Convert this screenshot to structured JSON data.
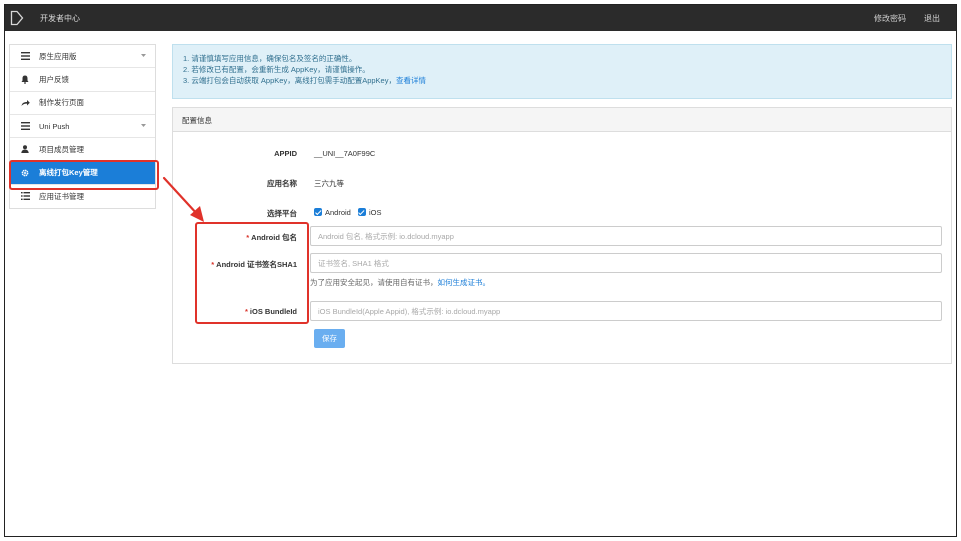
{
  "topbar": {
    "title": "开发者中心",
    "change_password": "修改密码",
    "logout": "退出"
  },
  "sidebar": {
    "items": [
      {
        "label": "原生应用版",
        "icon": "menu-icon",
        "has_caret": true
      },
      {
        "label": "用户反馈",
        "icon": "bell-icon",
        "has_caret": false
      },
      {
        "label": "制作发行页面",
        "icon": "share-arrow-icon",
        "has_caret": false
      },
      {
        "label": "Uni Push",
        "icon": "menu-icon",
        "has_caret": true
      },
      {
        "label": "项目成员管理",
        "icon": "user-icon",
        "has_caret": false
      },
      {
        "label": "离线打包Key管理",
        "icon": "gear-icon",
        "has_caret": false,
        "active": true
      },
      {
        "label": "应用证书管理",
        "icon": "list-icon",
        "has_caret": false
      }
    ]
  },
  "notice": {
    "line1": "1. 请谨慎填写应用信息，确保包名及签名的正确性。",
    "line2": "2. 若修改已有配置，会重新生成 AppKey，请谨慎操作。",
    "line3": "3. 云端打包会自动获取 AppKey，离线打包需手动配置AppKey，",
    "line3_link": "查看详情"
  },
  "panel": {
    "title": "配置信息",
    "appid_label": "APPID",
    "appid_value": "__UNI__7A0F99C",
    "appname_label": "应用名称",
    "appname_value": "三六九等",
    "platform_label": "选择平台",
    "platforms": [
      "Android",
      "iOS"
    ],
    "android_pkg_label": "Android 包名",
    "android_pkg_placeholder": "Android 包名, 格式示例: io.dcloud.myapp",
    "android_pkg_value": "",
    "android_sha1_label": "Android 证书签名SHA1",
    "android_sha1_placeholder": "证书签名, SHA1 格式",
    "android_sha1_value": "",
    "sha1_help": "为了应用安全起见，请使用自有证书，",
    "sha1_help_link": "如何生成证书。",
    "ios_bundle_label": "iOS BundleId",
    "ios_bundle_placeholder": "iOS BundleId(Apple Appid), 格式示例: io.dcloud.myapp",
    "ios_bundle_value": "",
    "required_mark": "*",
    "save_label": "保存"
  },
  "colors": {
    "topbar_bg": "#2b2b2b",
    "accent": "#1b7ed8",
    "highlight_red": "#e0322a",
    "notice_bg": "#dff0f8"
  }
}
